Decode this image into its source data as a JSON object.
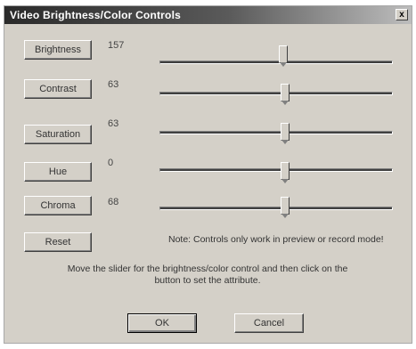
{
  "window": {
    "title": "Video Brightness/Color Controls",
    "close_glyph": "x"
  },
  "controls": [
    {
      "label": "Brightness",
      "value": "157",
      "level": 0.53
    },
    {
      "label": "Contrast",
      "value": "63",
      "level": 0.54
    },
    {
      "label": "Saturation",
      "value": "63",
      "level": 0.54
    },
    {
      "label": "Hue",
      "value": "0",
      "level": 0.54
    },
    {
      "label": "Chroma",
      "value": "68",
      "level": 0.54
    }
  ],
  "reset_label": "Reset",
  "note": "Note: Controls only work in preview or record mode!",
  "instructions": "Move the slider for the brightness/color control and then click on the button to set the attribute.",
  "buttons": {
    "ok": "OK",
    "cancel": "Cancel"
  }
}
